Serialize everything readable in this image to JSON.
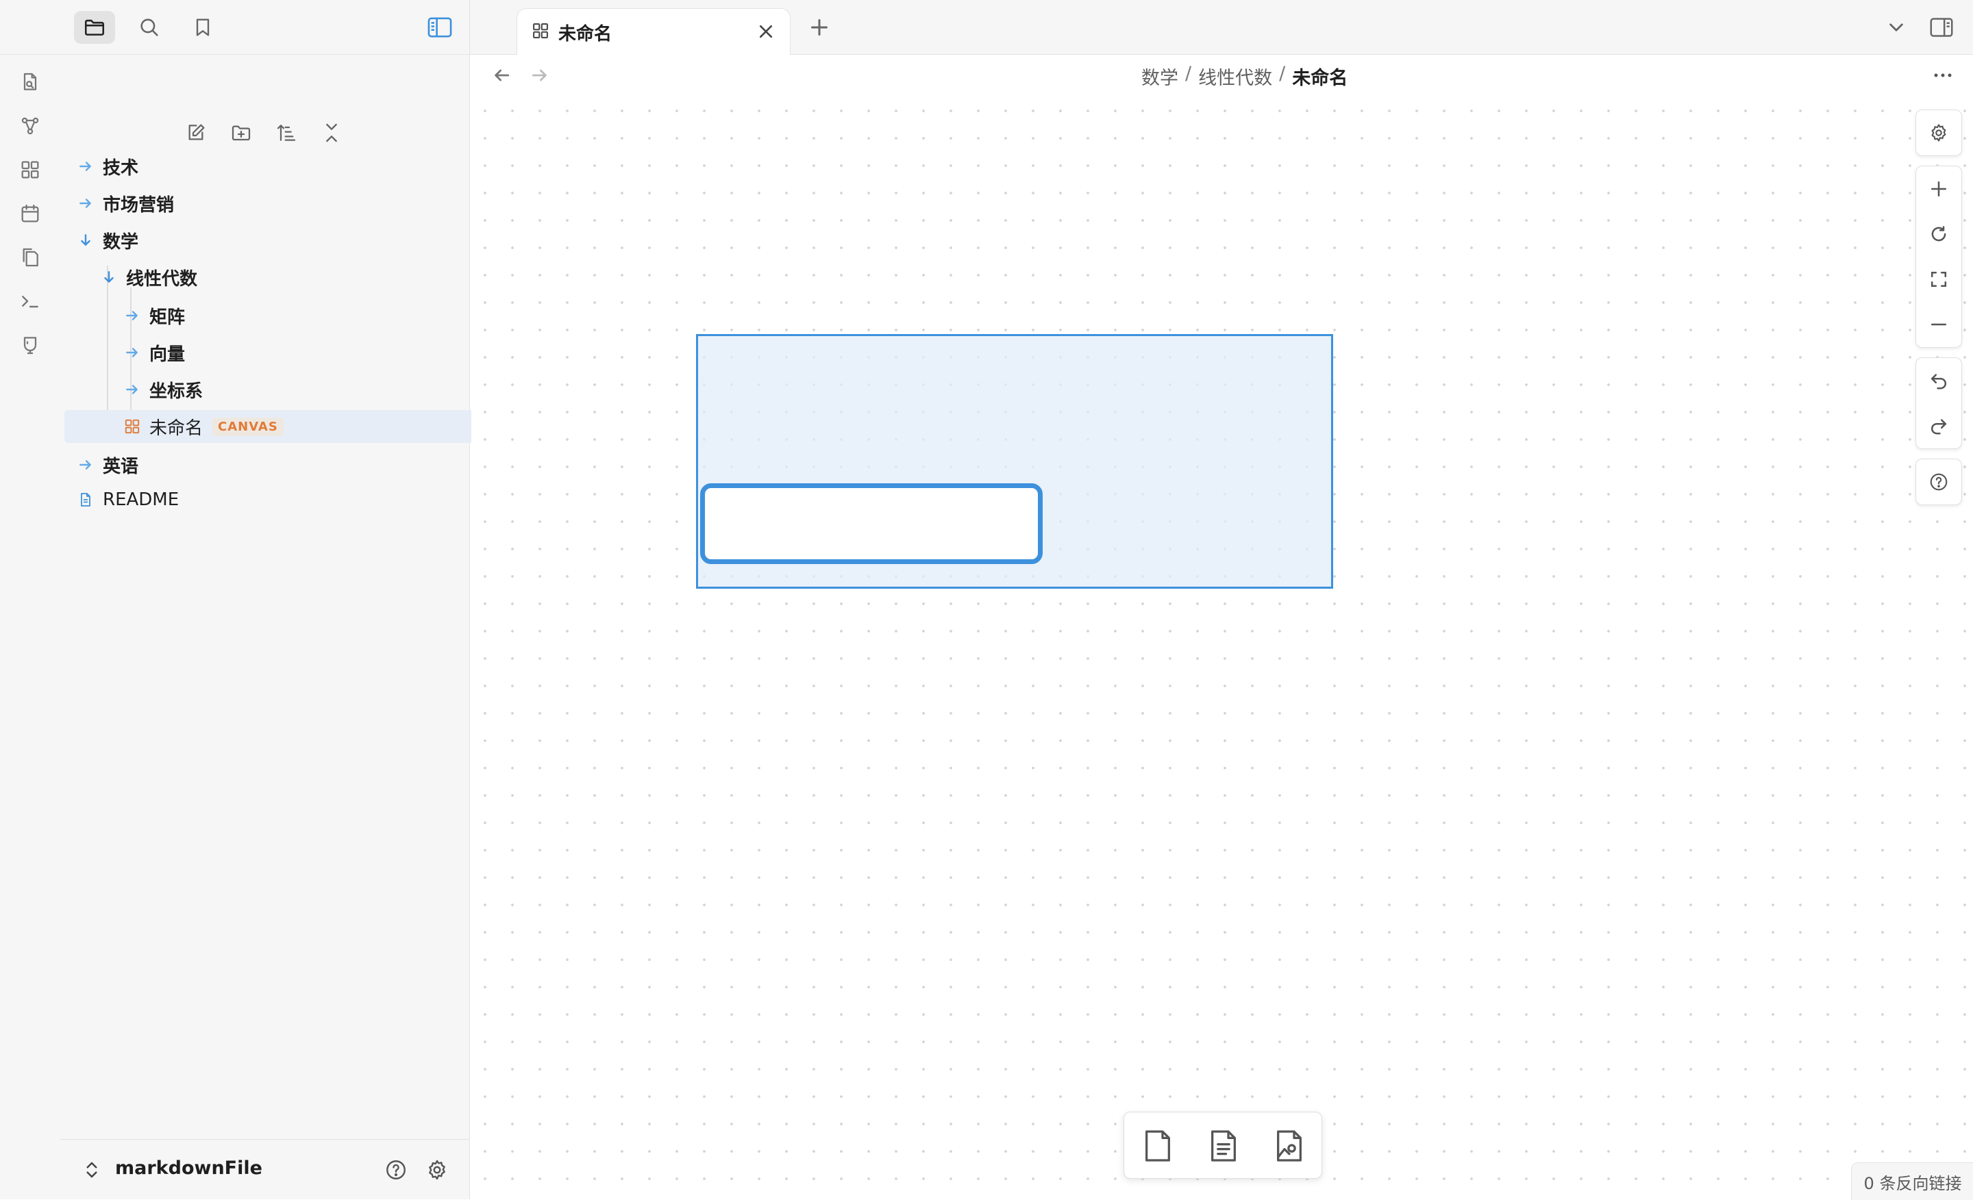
{
  "sidebar_top": {
    "icons": [
      "folder-icon",
      "search-icon",
      "bookmark-icon",
      "sidebar-toggle-icon"
    ]
  },
  "ribbon": {
    "icons": [
      "open-switcher-icon",
      "graph-view-icon",
      "canvas-icon",
      "daily-note-icon",
      "templates-icon",
      "command-palette-icon",
      "publish-icon"
    ]
  },
  "file_nav": {
    "actions": [
      "new-note-icon",
      "new-folder-icon",
      "sort-icon",
      "collapse-all-icon"
    ]
  },
  "tree": [
    {
      "label": "技术",
      "type": "folder",
      "expanded": false,
      "depth": 0
    },
    {
      "label": "市场营销",
      "type": "folder",
      "expanded": false,
      "depth": 0
    },
    {
      "label": "数学",
      "type": "folder",
      "expanded": true,
      "depth": 0
    },
    {
      "label": "线性代数",
      "type": "folder",
      "expanded": true,
      "depth": 1
    },
    {
      "label": "矩阵",
      "type": "folder",
      "expanded": false,
      "depth": 2
    },
    {
      "label": "向量",
      "type": "folder",
      "expanded": false,
      "depth": 2
    },
    {
      "label": "坐标系",
      "type": "folder",
      "expanded": false,
      "depth": 2
    },
    {
      "label": "未命名",
      "type": "canvas",
      "badge": "CANVAS",
      "selected": true,
      "depth": 2
    },
    {
      "label": "英语",
      "type": "folder",
      "expanded": false,
      "depth": 0
    },
    {
      "label": "README",
      "type": "note",
      "depth": 0
    }
  ],
  "footer": {
    "vault_name": "markdownFile"
  },
  "tab": {
    "title": "未命名"
  },
  "breadcrumb": {
    "parts": [
      "数学",
      "线性代数"
    ],
    "separator": "/",
    "current": "未命名"
  },
  "status_bar": {
    "backlinks": "0 条反向链接"
  },
  "colors": {
    "accent": "#3d91dc",
    "folder_arrow": "#63a9e8",
    "canvas_badge": "#e07b39",
    "selection": "#e6edf7"
  }
}
